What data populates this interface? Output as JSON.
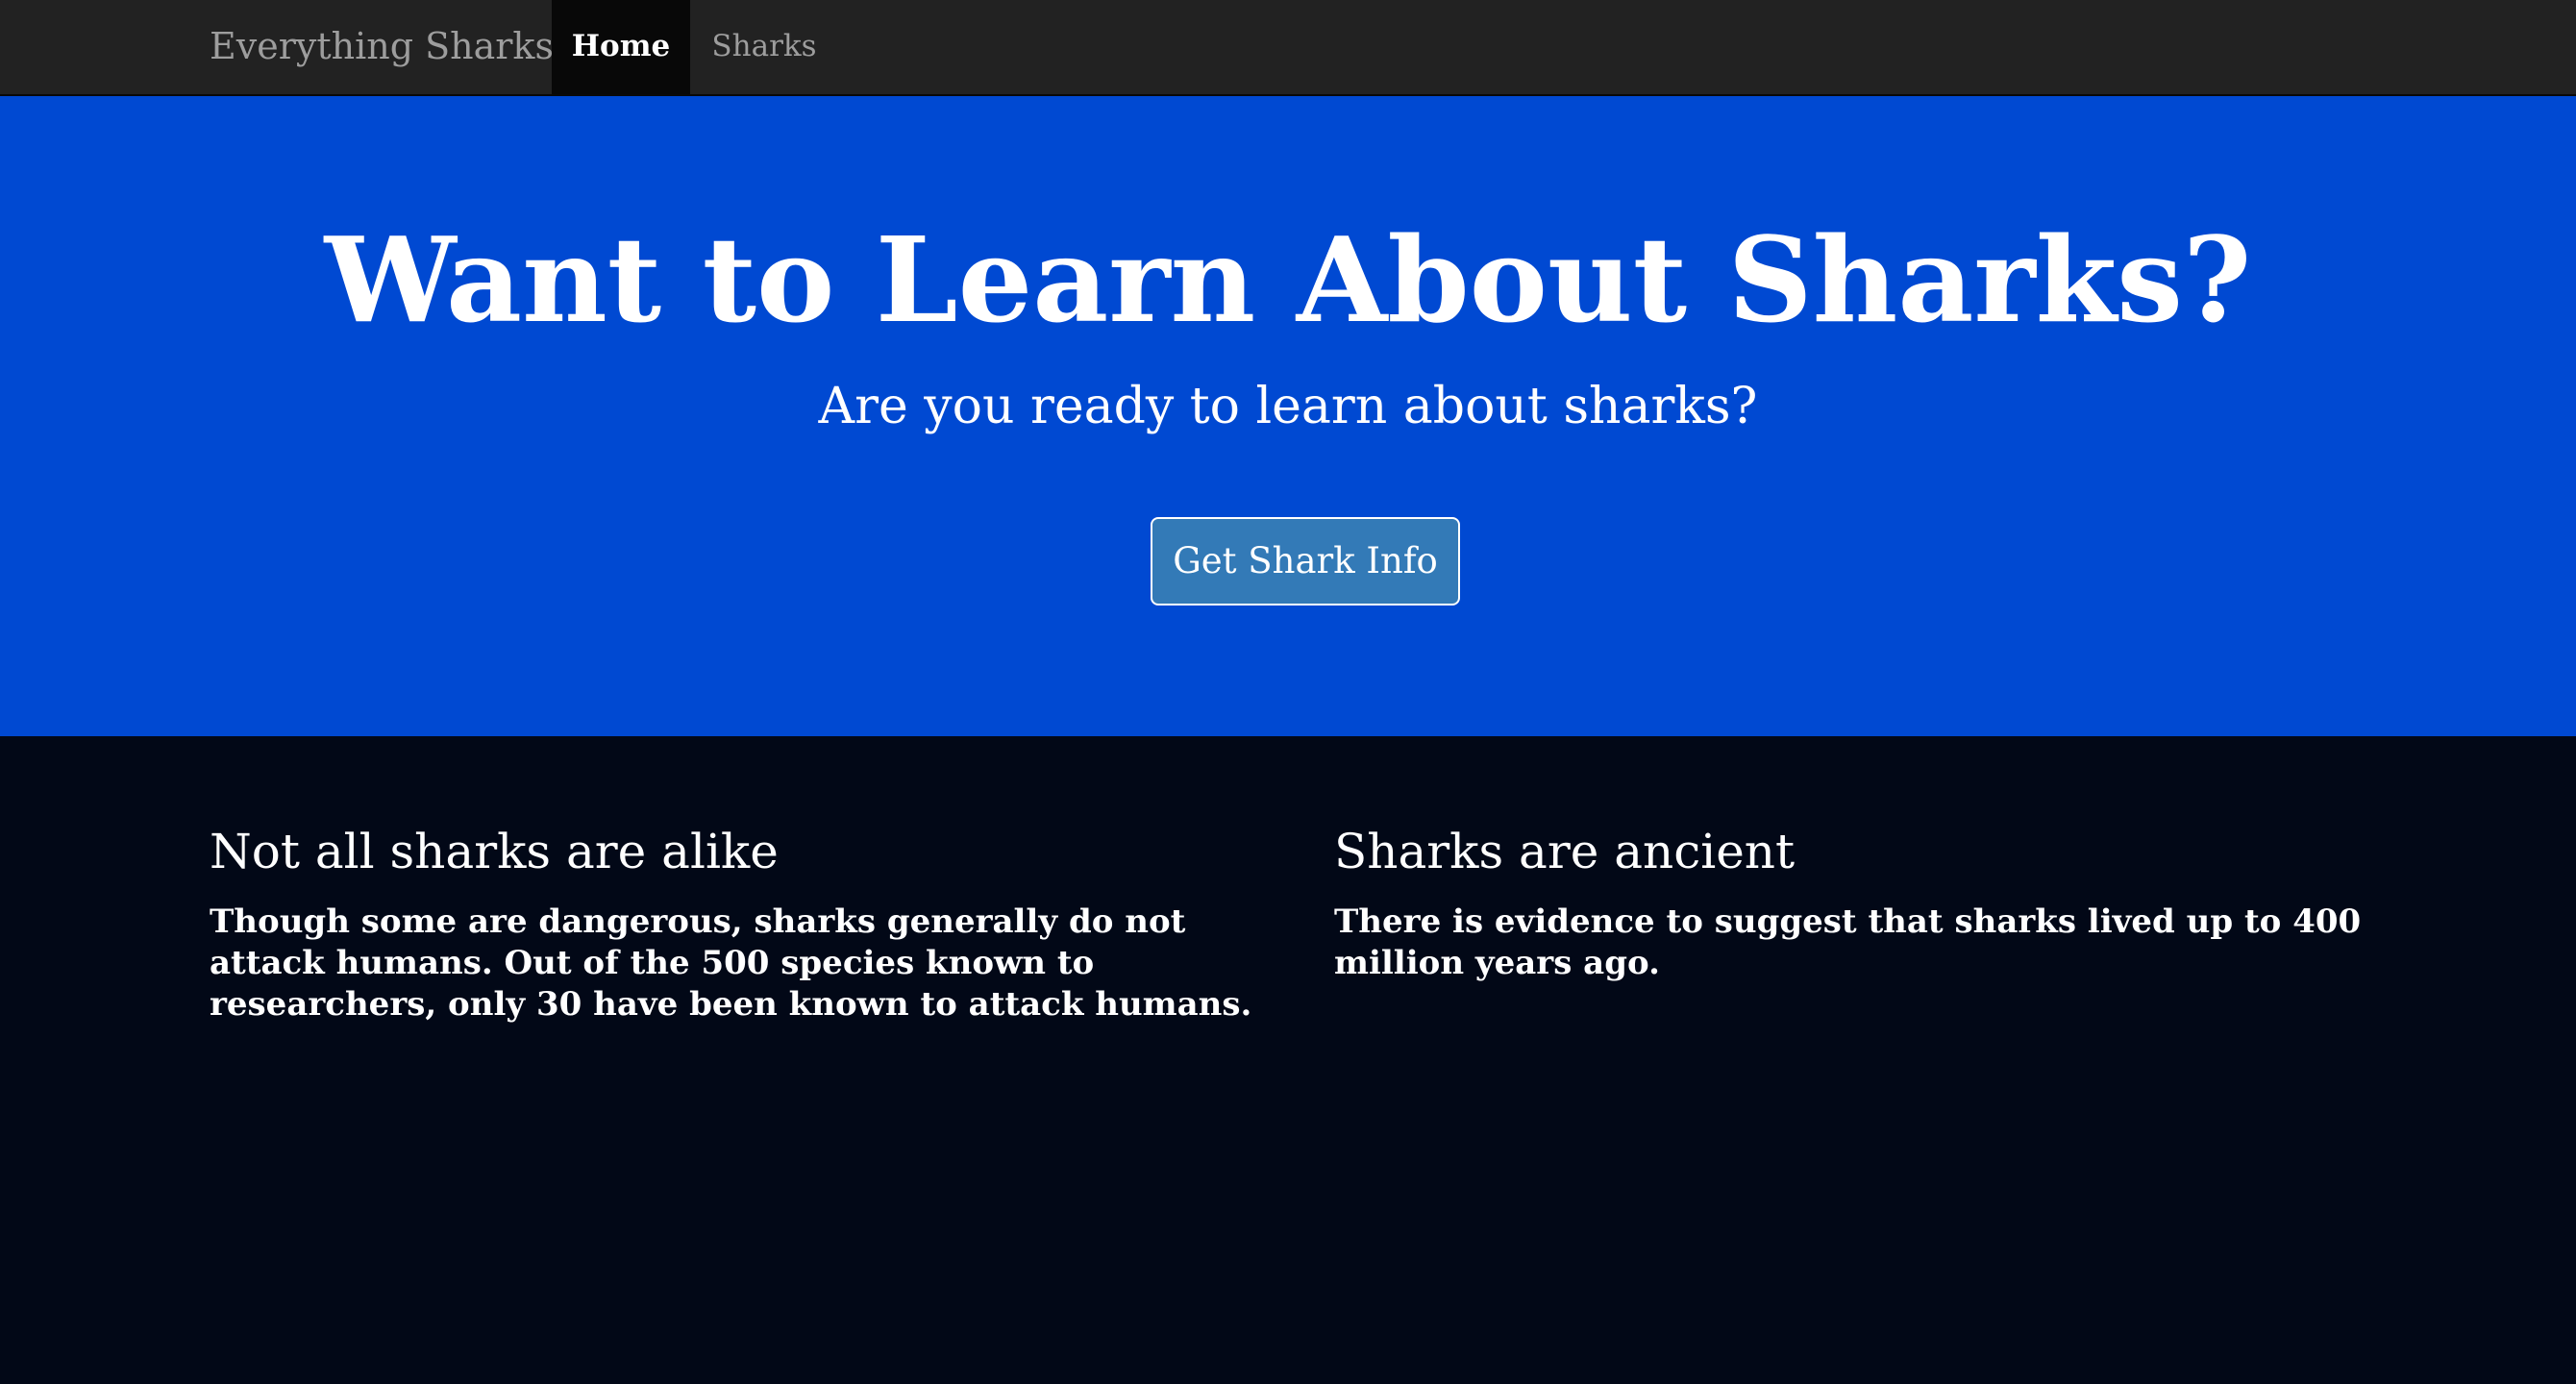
{
  "navbar": {
    "brand": "Everything Sharks",
    "items": [
      {
        "label": "Home",
        "active": true
      },
      {
        "label": "Sharks",
        "active": false
      }
    ]
  },
  "hero": {
    "title": "Want to Learn About Sharks?",
    "subtitle": "Are you ready to learn about sharks?",
    "button_label": "Get Shark Info"
  },
  "columns": [
    {
      "heading": "Not all sharks are alike",
      "body": "Though some are dangerous, sharks generally do not attack humans. Out of the 500 species known to researchers, only 30 have been known to attack humans."
    },
    {
      "heading": "Sharks are ancient",
      "body": "There is evidence to suggest that sharks lived up to 400 million years ago."
    }
  ],
  "colors": {
    "navbar_bg": "#222222",
    "nav_active_bg": "#080808",
    "hero_bg": "#0049d2",
    "button_bg": "#337ab7",
    "page_bg": "#020817"
  }
}
